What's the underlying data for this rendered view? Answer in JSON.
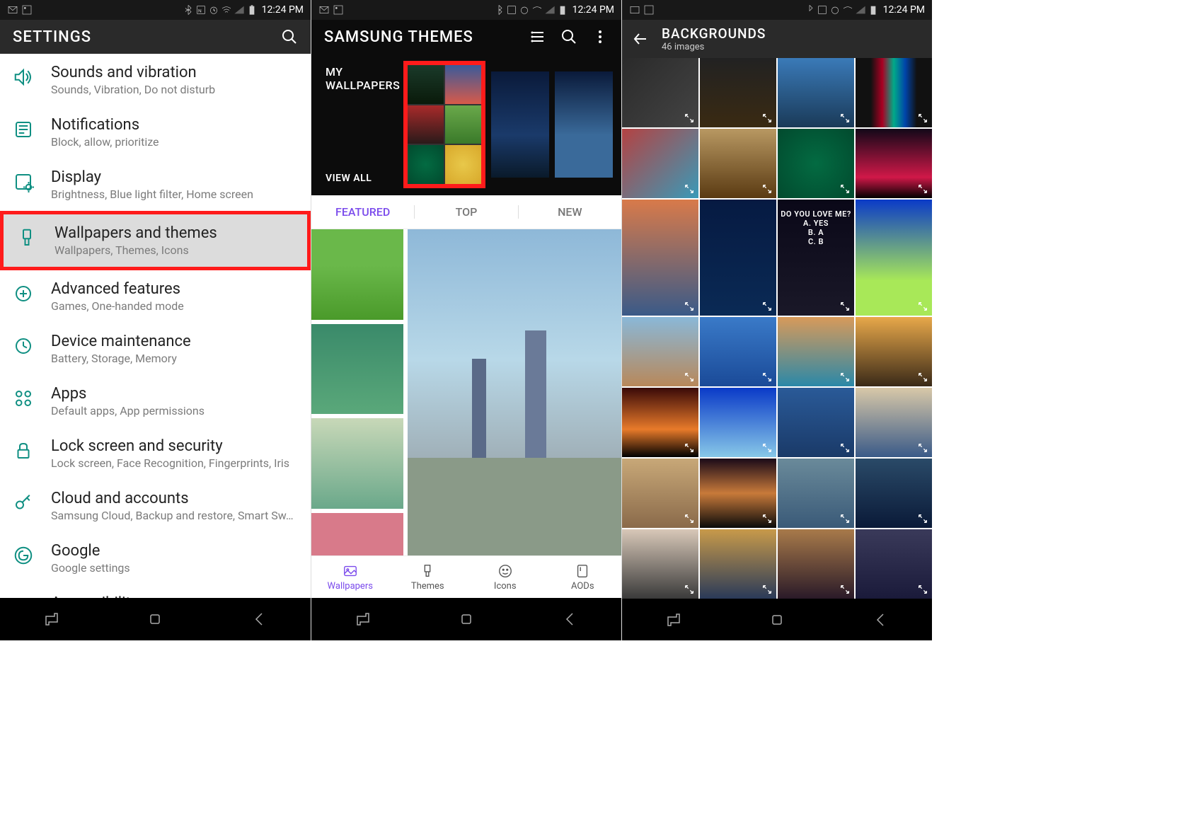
{
  "status": {
    "time": "12:24 PM"
  },
  "phone1": {
    "header_title": "SETTINGS",
    "items": [
      {
        "title": "Sounds and vibration",
        "sub": "Sounds, Vibration, Do not disturb"
      },
      {
        "title": "Notifications",
        "sub": "Block, allow, prioritize"
      },
      {
        "title": "Display",
        "sub": "Brightness, Blue light filter, Home screen"
      },
      {
        "title": "Wallpapers and themes",
        "sub": "Wallpapers, Themes, Icons"
      },
      {
        "title": "Advanced features",
        "sub": "Games, One-handed mode"
      },
      {
        "title": "Device maintenance",
        "sub": "Battery, Storage, Memory"
      },
      {
        "title": "Apps",
        "sub": "Default apps, App permissions"
      },
      {
        "title": "Lock screen and security",
        "sub": "Lock screen, Face Recognition, Fingerprints, Iris"
      },
      {
        "title": "Cloud and accounts",
        "sub": "Samsung Cloud, Backup and restore, Smart Sw…"
      },
      {
        "title": "Google",
        "sub": "Google settings"
      },
      {
        "title": "Accessibility",
        "sub": ""
      }
    ]
  },
  "phone2": {
    "header_title": "SAMSUNG THEMES",
    "my_wallpapers_l1": "MY",
    "my_wallpapers_l2": "WALLPAPERS",
    "view_all": "VIEW ALL",
    "tabs": [
      "FEATURED",
      "TOP",
      "NEW"
    ],
    "bottom_nav": [
      "Wallpapers",
      "Themes",
      "Icons",
      "AODs"
    ]
  },
  "phone3": {
    "title": "BACKGROUNDS",
    "sub": "46 images",
    "annot_l1": "DO YOU LOVE ME?",
    "annot_l2": "A. YES",
    "annot_l3": "B. A",
    "annot_l4": "C. B"
  },
  "grid_colors": [
    "linear-gradient(135deg,#2a2a2a,#444)",
    "linear-gradient(#222,#3a2a12)",
    "linear-gradient(#3a7ab8,#1a3a58)",
    "linear-gradient(90deg,#111 20%,#a02,#0a8,#04a,#111 80%)",
    "linear-gradient(135deg,#b44242,#3a9ab8)",
    "linear-gradient(#b89862,#5a3a12)",
    "radial-gradient(circle,#036b42,#024a2e)",
    "linear-gradient(#120818,#d01848 70%,#000)",
    "linear-gradient(#d87a4a,#3a5a88)",
    "linear-gradient(#061a42,#0a2a55)",
    "linear-gradient(#0a0818,#1a1828)",
    "linear-gradient(#0a3ac8,#a8e858 70%)",
    "linear-gradient(#8ab8d8,#b8885a)",
    "linear-gradient(#3a7ac8,#1a4a98)",
    "linear-gradient(#d89a5a,#2a88a8)",
    "linear-gradient(#e8a84a,#3a2a18)",
    "linear-gradient(#3a0a08,#e87a2a 60%,#000)",
    "linear-gradient(#0a3ac8,#88c8e8)",
    "linear-gradient(#2a5a98,#1a3a68)",
    "linear-gradient(#d8c8a8,#3a5a88)",
    "linear-gradient(#c8a878,#8a6a4a)",
    "linear-gradient(#1a0a18,#c87a3a 50%,#0a0a0a)",
    "linear-gradient(#6a8a9a,#3a5a78)",
    "linear-gradient(#2a4a68,#0a1a38)",
    "linear-gradient(#d8c8b8,#3a3a3a)",
    "linear-gradient(#c89a4a,#2a3a58)",
    "linear-gradient(#a87a4a,#2a1a28)",
    "linear-gradient(#3a3a5a,#1a1a3a)"
  ]
}
